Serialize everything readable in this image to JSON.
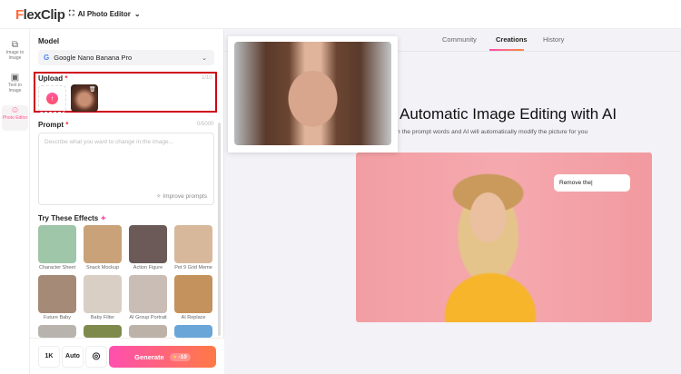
{
  "header": {
    "logo": "FlexClip",
    "product": "AI Photo Editor"
  },
  "rail": [
    {
      "label": "Image to Image",
      "icon": "image-to-image-icon"
    },
    {
      "label": "Text to Image",
      "icon": "text-to-image-icon"
    },
    {
      "label": "Photo Editor",
      "icon": "photo-editor-icon",
      "active": true
    }
  ],
  "panel": {
    "model_label": "Model",
    "model_value": "Google Nano Banana Pro",
    "upload_label": "Upload",
    "upload_count": "1/10",
    "prompt_label": "Prompt",
    "prompt_count": "0/5000",
    "prompt_placeholder": "Describe what you want to change in the image...",
    "improve": "Improve prompts",
    "effects_label": "Try These Effects",
    "effects": [
      {
        "label": "Character Sheet",
        "color": "#9fc6a8"
      },
      {
        "label": "Snack Mockup",
        "color": "#c9a27a"
      },
      {
        "label": "Action Figure",
        "color": "#6b5a58"
      },
      {
        "label": "Pet 9 Grid Meme",
        "color": "#d8b89a"
      },
      {
        "label": "Future Baby",
        "color": "#a68a78"
      },
      {
        "label": "Baby Filter",
        "color": "#d9cfc5"
      },
      {
        "label": "AI Group Portrait",
        "color": "#c9bdb6"
      },
      {
        "label": "AI Replace",
        "color": "#c4925c"
      },
      {
        "label": "",
        "color": "#b9b3ad"
      },
      {
        "label": "",
        "color": "#7e8a4c"
      },
      {
        "label": "",
        "color": "#bdb2a8"
      },
      {
        "label": "",
        "color": "#6aa6d8"
      }
    ],
    "resolution": "1K",
    "ratio": "Auto",
    "generate": "Generate",
    "cost": "-10"
  },
  "main": {
    "tabs": [
      "Community",
      "Creations",
      "History"
    ],
    "active_tab": "Creations",
    "title": "Automatic Image Editing with AI",
    "subtitle": "l in the prompt words and AI will automatically modify the picture for you",
    "bubble": "Remove the|"
  },
  "colors": {
    "accent": "#ff4fb0",
    "accent2": "#ff7a45",
    "highlight": "#d0021b"
  }
}
